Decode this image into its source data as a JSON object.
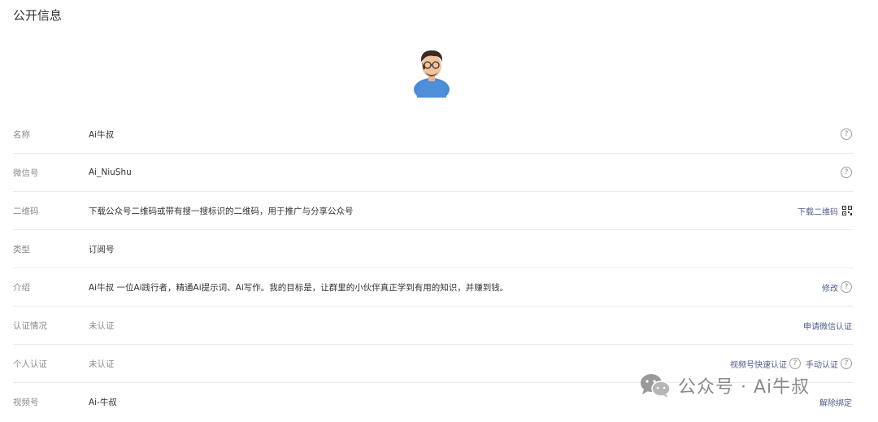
{
  "section_title": "公开信息",
  "avatar_icon": "avatar-cartoon-man-glasses",
  "rows": [
    {
      "label": "名称",
      "value": "Ai牛叔",
      "help": "?"
    },
    {
      "label": "微信号",
      "value": "Ai_NiuShu",
      "help": "?"
    },
    {
      "label": "二维码",
      "value": "下载公众号二维码或带有搜一搜标识的二维码，用于推广与分享公众号",
      "action": "下载二维码"
    },
    {
      "label": "类型",
      "value": "订阅号"
    },
    {
      "label": "介绍",
      "value": "Ai牛叔 一位Ai践行者，精通Ai提示词、Ai写作。我的目标是，让群里的小伙伴真正学到有用的知识，并赚到钱。",
      "action": "修改",
      "help": "?"
    },
    {
      "label": "认证情况",
      "value": "未认证",
      "action": "申请微信认证"
    },
    {
      "label": "个人认证",
      "value": "未认证",
      "action": "视频号快速认证",
      "help": "?",
      "action2": "手动认证",
      "help2": "?"
    },
    {
      "label": "视频号",
      "value": "Ai-牛叔",
      "action": "解除绑定"
    }
  ],
  "watermark": {
    "text": "公众号 · Ai牛叔",
    "icon": "wechat-logo-icon"
  },
  "colors": {
    "link": "#4f5d8a",
    "label": "#8a8a8a",
    "divider": "#ebebeb"
  }
}
